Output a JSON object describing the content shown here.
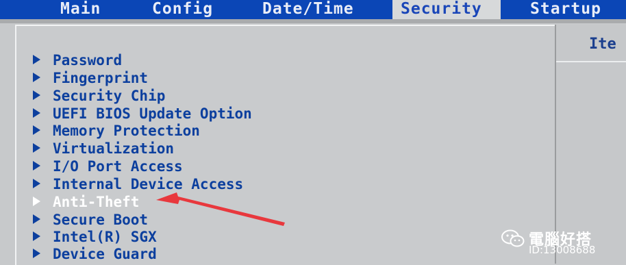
{
  "tabs": [
    {
      "label": "Main"
    },
    {
      "label": "Config"
    },
    {
      "label": "Date/Time"
    },
    {
      "label": "Security",
      "active": true
    },
    {
      "label": "Startup"
    }
  ],
  "right_panel": {
    "header": "Ite"
  },
  "menu": [
    {
      "label": "Password"
    },
    {
      "label": "Fingerprint"
    },
    {
      "label": "Security Chip"
    },
    {
      "label": "UEFI BIOS Update Option"
    },
    {
      "label": "Memory Protection"
    },
    {
      "label": "Virtualization"
    },
    {
      "label": "I/O Port Access"
    },
    {
      "label": "Internal Device Access"
    },
    {
      "label": "Anti-Theft",
      "selected": true
    },
    {
      "label": "Secure Boot"
    },
    {
      "label": "Intel(R) SGX"
    },
    {
      "label": "Device Guard"
    }
  ],
  "watermark": {
    "name": "電腦好搭",
    "id": "ID:13008688"
  },
  "colors": {
    "tab_bar": "#0b46b6",
    "menu_text": "#0c3f9e",
    "selected_text": "#ffffff",
    "arrow_annotation": "#e8383d"
  }
}
